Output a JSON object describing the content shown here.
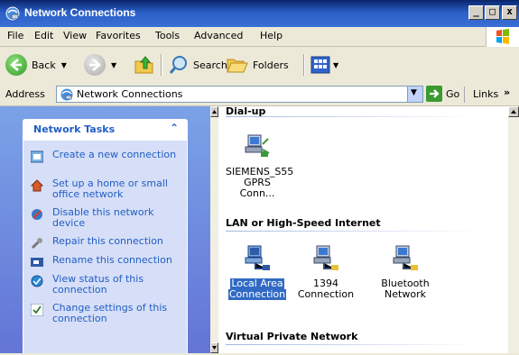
{
  "window": {
    "title": "Network Connections"
  },
  "title_buttons": {
    "minimize": "_",
    "maximize": "□",
    "close": "x"
  },
  "menu": [
    "File",
    "Edit",
    "View",
    "Favorites",
    "Tools",
    "Advanced",
    "Help"
  ],
  "toolbar": {
    "back": "Back",
    "search": "Search",
    "folders": "Folders"
  },
  "address": {
    "label": "Address",
    "value": "Network Connections",
    "go": "Go",
    "links": "Links",
    "more": "»"
  },
  "tasks": {
    "title": "Network Tasks",
    "items": [
      {
        "label": "Create a new connection",
        "icon": "new-connection-icon"
      },
      {
        "label": "Set up a home or small office network",
        "icon": "home-network-icon"
      },
      {
        "label": "Disable this network device",
        "icon": "disable-device-icon"
      },
      {
        "label": "Repair this connection",
        "icon": "repair-icon"
      },
      {
        "label": "Rename this connection",
        "icon": "rename-icon"
      },
      {
        "label": "View status of this connection",
        "icon": "status-icon"
      },
      {
        "label": "Change settings of this connection",
        "icon": "settings-icon"
      }
    ]
  },
  "groups": {
    "dialup": {
      "title": "Dial-up",
      "items": [
        {
          "line1": "SIEMENS_S55",
          "line2": "GPRS Conn..."
        }
      ]
    },
    "lan": {
      "title": "LAN or High-Speed Internet",
      "items": [
        {
          "line1": "Local Area",
          "line2": "Connection",
          "selected": true
        },
        {
          "line1": "1394",
          "line2": "Connection"
        },
        {
          "line1": "Bluetooth",
          "line2": "Network"
        }
      ]
    },
    "vpn": {
      "title": "Virtual Private Network"
    }
  },
  "colors": {
    "titlebar": "#0a246a",
    "task_link": "#215dc6",
    "selection": "#316ac5"
  }
}
